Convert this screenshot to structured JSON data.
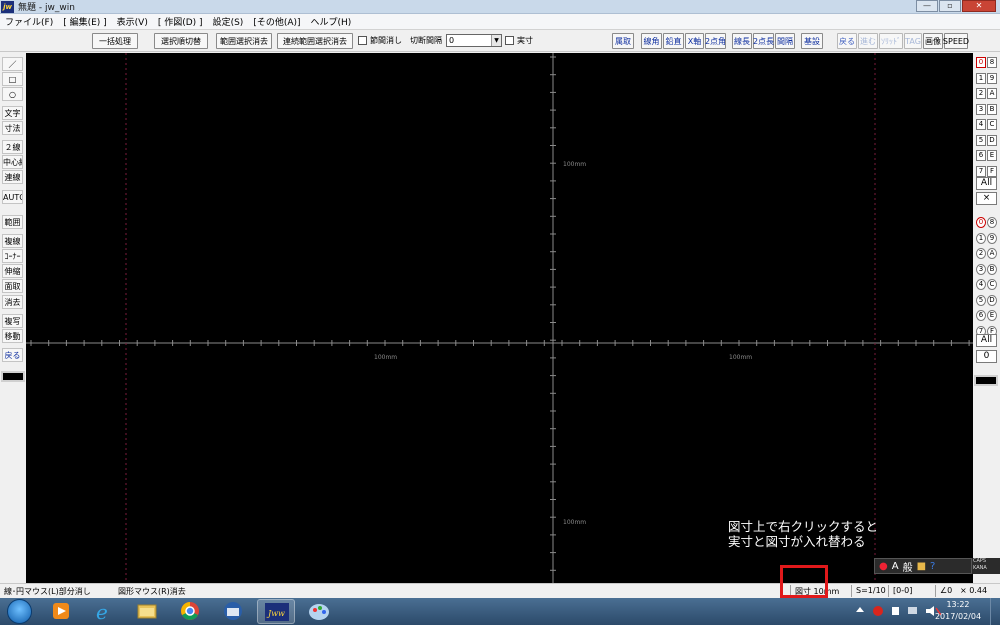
{
  "window": {
    "app_icon": "jw",
    "title": "無題 - jw_win",
    "buttons": {
      "minimize": "—",
      "maximize": "▫",
      "close": "✕"
    }
  },
  "menu": [
    "ファイル(F)",
    "[ 編集(E) ]",
    "表示(V)",
    "[ 作図(D) ]",
    "設定(S)",
    "[その他(A)]",
    "ヘルプ(H)"
  ],
  "toolbar": {
    "buttons": [
      "一括処理",
      "選択順切替",
      "範囲選択消去",
      "連続範囲選択消去"
    ],
    "check1": "節間消し",
    "interval_label": "切断間隔",
    "interval_value": "0",
    "check2": "実寸",
    "right_buttons": [
      "属取",
      "線角",
      "鉛直",
      "X軸",
      "2点角",
      "線長",
      "2点長",
      "間隔",
      "基設"
    ],
    "right_buttons2": [
      "戻る",
      "進む",
      "ｿﾘｯﾄﾞ",
      "TAG",
      "画像",
      "SPEED"
    ]
  },
  "left_tools": [
    "／",
    "□",
    "○",
    "文字",
    "寸法",
    "２線",
    "中心線",
    "連線",
    "AUTO",
    "範囲",
    "複線",
    "ｺｰﾅｰ",
    "伸縮",
    "面取",
    "消去",
    "複写",
    "移動",
    "戻る"
  ],
  "canvas": {
    "background": "#000000",
    "scale_labels": [
      "100mm",
      "100mm",
      "100mm",
      "100mm"
    ]
  },
  "right_panel": {
    "layer_group_left": [
      "0",
      "1",
      "2",
      "3",
      "4",
      "5",
      "6",
      "7"
    ],
    "layer_group_right": [
      "8",
      "9",
      "A",
      "B",
      "C",
      "D",
      "E",
      "F"
    ],
    "all_label": "All",
    "x_label": "×",
    "layer_left": [
      "0",
      "1",
      "2",
      "3",
      "4",
      "5",
      "6",
      "7"
    ],
    "layer_right": [
      "8",
      "9",
      "A",
      "B",
      "C",
      "D",
      "E",
      "F"
    ],
    "all_label2": "All",
    "zero_label": "0"
  },
  "annotation": {
    "line1": "図寸上で右クリックすると",
    "line2": "実寸と図寸が入れ替わる"
  },
  "ime": {
    "mode": "A",
    "kanji": "般",
    "side_top": "CAPS",
    "side_bottom": "KANA"
  },
  "status": {
    "left_text": "線･円マウス(L)部分消し",
    "mid_text": "図形マウス(R)消去",
    "dimension": "図寸 10mm",
    "scale": "S=1/10",
    "layer": "[0-0]",
    "angle": "∠0",
    "zoom": "× 0.44"
  },
  "taskbar": {
    "time": "13:22",
    "date": "2017/02/04",
    "apps": [
      "media-player",
      "internet-explorer",
      "file-explorer",
      "chrome",
      "thunderbird",
      "jw-cad",
      "paint"
    ]
  },
  "colors": {
    "accent_red": "#e0191b",
    "canvas_bg": "#000000",
    "axis_line": "#8a8a8a",
    "guide_dot": "#7a1a3a"
  }
}
